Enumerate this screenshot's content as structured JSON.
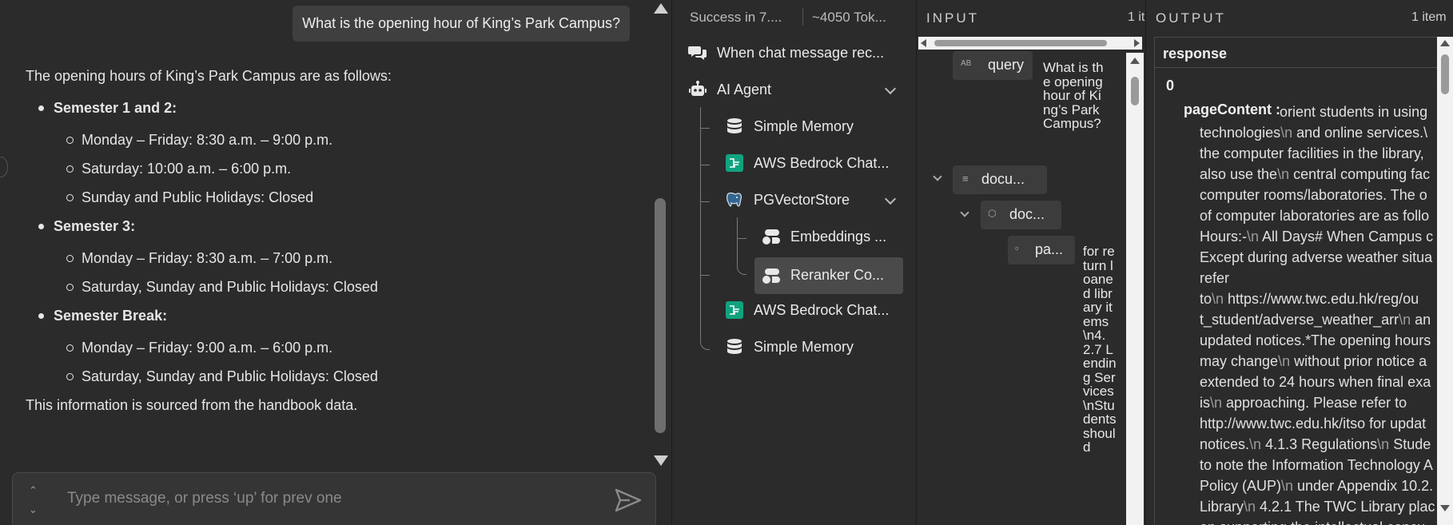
{
  "chat": {
    "user_message": "What is the opening hour of King’s Park Campus?",
    "bot_intro": "The opening hours of King’s Park Campus are as follows:",
    "sections": [
      {
        "title": "Semester 1 and 2:",
        "items": [
          "Monday – Friday: 8:30 a.m. – 9:00 p.m.",
          "Saturday: 10:00 a.m. – 6:00 p.m.",
          "Sunday and Public Holidays: Closed"
        ]
      },
      {
        "title": "Semester 3:",
        "items": [
          "Monday – Friday: 8:30 a.m. – 7:00 p.m.",
          "Saturday, Sunday and Public Holidays: Closed"
        ]
      },
      {
        "title": "Semester Break:",
        "items": [
          "Monday – Friday: 9:00 a.m. – 6:00 p.m.",
          "Saturday, Sunday and Public Holidays: Closed"
        ]
      }
    ],
    "bot_source": "This information is sourced from the handbook data.",
    "composer": {
      "placeholder": "Type message, or press ‘up’ for prev one"
    }
  },
  "logs": {
    "status": "Success in 7....",
    "tokens": "~4050 Tok...",
    "items": [
      {
        "label": "When chat message rec...",
        "icon": "chat-bubbles-icon"
      },
      {
        "label": "AI Agent",
        "icon": "robot-icon"
      },
      {
        "label": "Simple Memory",
        "icon": "database-icon"
      },
      {
        "label": "AWS Bedrock Chat...",
        "icon": "bedrock-icon"
      },
      {
        "label": "PGVectorStore",
        "icon": "postgres-elephant-icon"
      },
      {
        "label": "Embeddings ...",
        "icon": "cohere-icon"
      },
      {
        "label": "Reranker Co...",
        "icon": "cohere-icon"
      },
      {
        "label": "AWS Bedrock Chat...",
        "icon": "bedrock-icon"
      },
      {
        "label": "Simple Memory",
        "icon": "database-icon"
      }
    ]
  },
  "input": {
    "title": "INPUT",
    "count": "1 it",
    "query_key": "query",
    "query_icon": "AB",
    "query_value": "What is the opening hour of King’s Park Campus?",
    "docs_key": "docu...",
    "doc_key": "doc...",
    "page_key": "pa...",
    "page_value": "for return loaned library items\\n4.2.7 Lending Services\\nStudents should"
  },
  "output": {
    "title": "OUTPUT",
    "count": "1 item",
    "column_header": "response",
    "index": "0",
    "page_content_key": "pageContent",
    "lines": [
      "orient students in using",
      "technologies\\n and online services.\\",
      "the computer facilities in the library,",
      "also use the\\n central computing fac",
      "computer rooms/laboratories. The o",
      "of computer laboratories are as follo",
      "Hours:-\\n All Days# When Campus c",
      "Except during adverse weather situa",
      "refer",
      "to\\n https://www.twc.edu.hk/reg/ou",
      "t_student/adverse_weather_arr\\n an",
      "updated notices.*The opening hours",
      "may change\\n without prior notice a",
      "extended to 24 hours when final exa",
      "is\\n approaching. Please refer to",
      "http://www.twc.edu.hk/itso for updat",
      "notices.\\n 4.1.3 Regulations\\n Stude",
      "to note the Information Technology A",
      "Policy (AUP)\\n under Appendix 10.2.",
      "Library\\n 4.2.1 The TWC Library plac",
      "on supporting the intellectual concu"
    ]
  },
  "colors": {
    "accent_green": "#10a37f",
    "selected_row": "#4a4a4a",
    "background": "#2b2b2b"
  }
}
